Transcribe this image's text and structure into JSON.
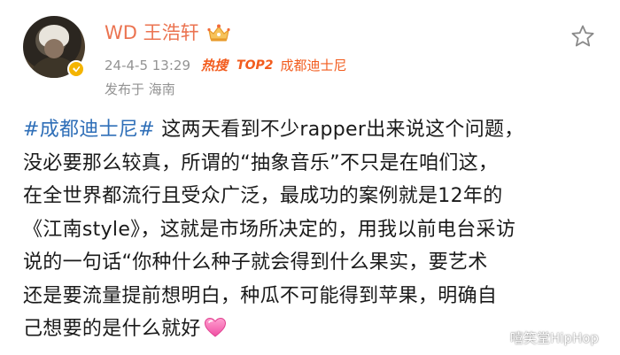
{
  "post": {
    "username": "WD 王浩轩",
    "timestamp": "24-4-5 13:29",
    "hot_label": "热搜",
    "top_label": "TOP2",
    "hot_topic": "成都迪士尼",
    "location": "发布于 海南",
    "hashtag": "#成都迪士尼#",
    "body_segments": [
      " 这两天看到不少rapper出来说这个问题，",
      "没必要那么较真，所谓的“抽象音乐”不只是在咱们这，",
      "在全世界都流行且受众广泛，最成功的案例就是12年的",
      "《江南style》，这就是市场所决定的，用我以前电台采访",
      "说的一句话“你种什么种子就会得到什么果实，要艺术",
      "还是要流量提前想明白，种瓜不可能得到苹果，明确自",
      "己想要的是什么就好"
    ]
  },
  "watermark": {
    "text": "嘻笑堂HipHop"
  },
  "colors": {
    "username": "#eb7350",
    "hashtag": "#2f6fb8",
    "hot": "#f25c1e",
    "meta": "#939393",
    "verified": "#f4b400"
  },
  "icons": {
    "verified": "verified-badge-icon",
    "crown": "crown-icon",
    "star": "star-outline-icon",
    "heart": "pink-heart-emoji",
    "watermark": "weibo-icon"
  }
}
